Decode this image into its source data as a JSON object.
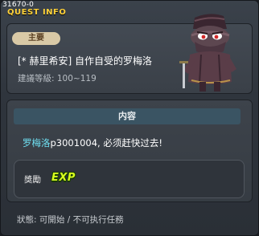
{
  "window": {
    "id": "31670-0",
    "title": "QUEST INFO"
  },
  "quest": {
    "category": "主要",
    "name": "[* 赫里希安] 自作自受的罗梅洛",
    "level": "建議等級: 100~119"
  },
  "content": {
    "header": "内容",
    "npc_name": "罗梅洛",
    "text_rest": "p3001004, 必须赶快过去!"
  },
  "reward": {
    "label": "獎勵",
    "exp_label": "EXP"
  },
  "status": {
    "text": "狀態: 可開始 / 不可执行任務"
  },
  "colors": {
    "title": "#ffd23a",
    "npc_link": "#6fe0f2",
    "exp": "#d8ff1e",
    "badge_bg": "#d9c9a6",
    "content_header_bg": "#3a5463"
  },
  "icons": {
    "npc": "npc-romero-portrait-icon",
    "exp": "exp-icon"
  }
}
